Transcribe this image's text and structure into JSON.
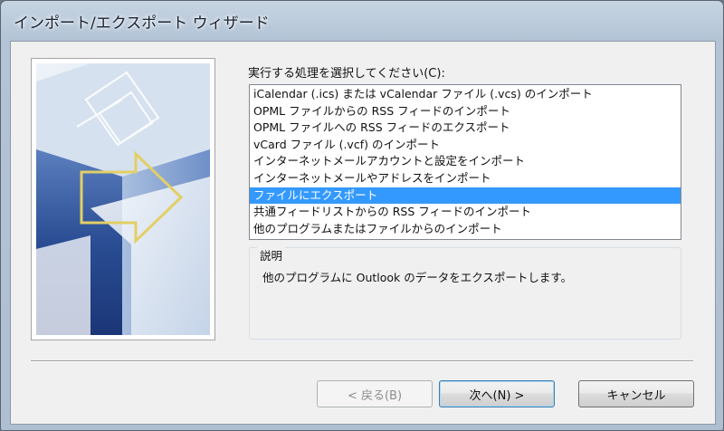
{
  "window": {
    "title": "インポート/エクスポート ウィザード"
  },
  "main": {
    "prompt": "実行する処理を選択してください(C):",
    "actions": [
      {
        "label": "iCalendar (.ics) または vCalendar ファイル (.vcs) のインポート",
        "selected": false
      },
      {
        "label": "OPML ファイルからの RSS フィードのインポート",
        "selected": false
      },
      {
        "label": "OPML ファイルへの RSS フィードのエクスポート",
        "selected": false
      },
      {
        "label": "vCard ファイル (.vcf) のインポート",
        "selected": false
      },
      {
        "label": "インターネットメールアカウントと設定をインポート",
        "selected": false
      },
      {
        "label": "インターネットメールやアドレスをインポート",
        "selected": false
      },
      {
        "label": "ファイルにエクスポート",
        "selected": true
      },
      {
        "label": "共通フィードリストからの RSS フィードのインポート",
        "selected": false
      },
      {
        "label": "他のプログラムまたはファイルからのインポート",
        "selected": false
      }
    ],
    "description_label": "説明",
    "description_text": "他のプログラムに Outlook のデータをエクスポートします。"
  },
  "buttons": {
    "back": "< 戻る(B)",
    "next": "次へ(N) >",
    "cancel": "キャンセル"
  },
  "colors": {
    "selection": "#3399ff",
    "banner_dark": "#1f3f82",
    "banner_light": "#dce6f2",
    "arrow_outline": "#e2cf66"
  }
}
